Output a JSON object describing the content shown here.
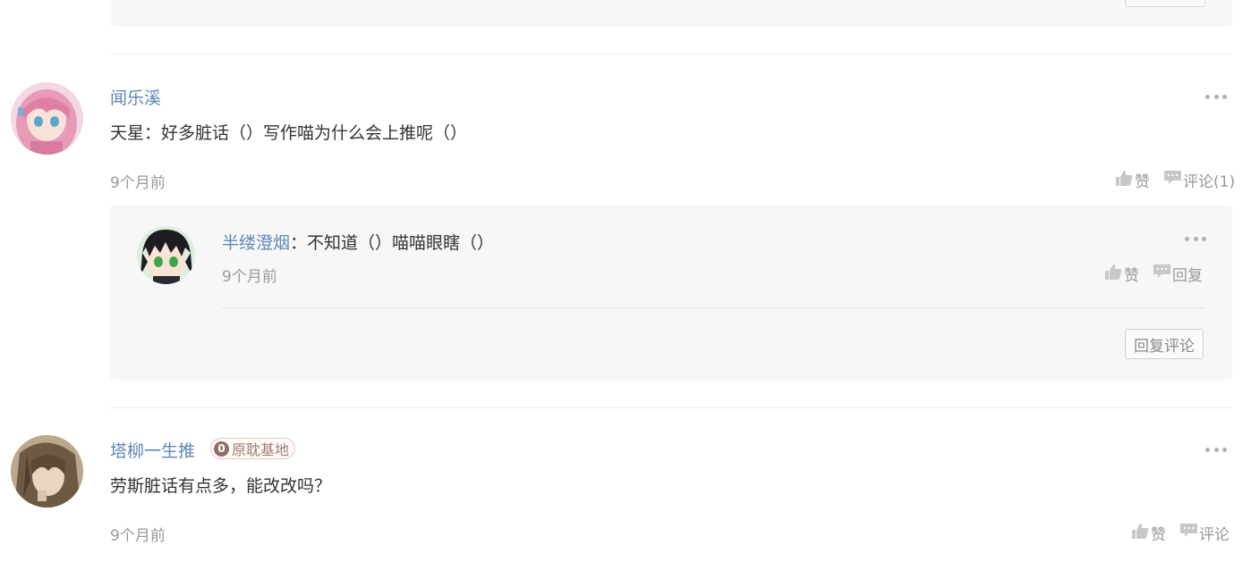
{
  "previous_comment": {
    "reply_button_label": ""
  },
  "comments": [
    {
      "username": "闻乐溪",
      "text": "天星：好多脏话（）写作喵为什么会上推呢（）",
      "time": "9个月前",
      "like_label": "赞",
      "comment_label": "评论(1)",
      "replies": [
        {
          "username": "半缕澄烟",
          "separator": "：",
          "text": "不知道（）喵喵眼瞎（）",
          "time": "9个月前",
          "like_label": "赞",
          "reply_label": "回复"
        }
      ],
      "reply_button_label": "回复评论"
    },
    {
      "username": "塔柳一生推",
      "badge": {
        "number": "0",
        "label": "原耽基地"
      },
      "text": "劳斯脏话有点多，能改改吗？",
      "time": "9个月前",
      "like_label": "赞",
      "comment_label": "评论"
    }
  ],
  "icons": {
    "more": "more-dots-icon",
    "like": "thumbs-up-icon",
    "comment": "speech-bubble-icon"
  },
  "colors": {
    "username": "#5f87b7",
    "muted": "#9a9a9a",
    "panel": "#f7f7f7"
  }
}
